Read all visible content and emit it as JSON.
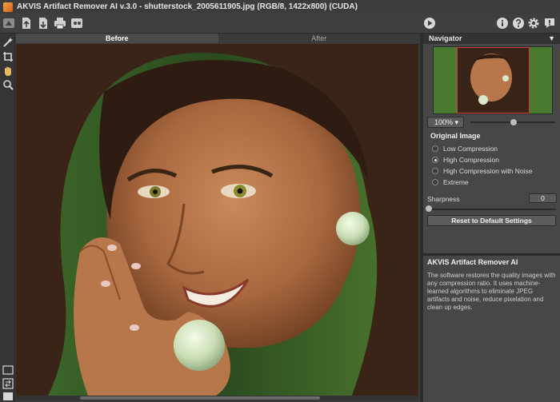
{
  "window": {
    "title": "AKVIS Artifact Remover AI v.3.0 - shutterstock_2005611905.jpg (RGB/8, 1422x800) (CUDA)"
  },
  "toolbar": {
    "left_icons": [
      "home-icon",
      "open-icon",
      "save-icon",
      "print-icon",
      "share-icon"
    ],
    "run_icon": "play-icon",
    "right_icons": [
      "about-icon",
      "help-icon",
      "settings-icon",
      "news-icon"
    ]
  },
  "left_tools": [
    "magic-wand-icon",
    "crop-icon",
    "hand-icon",
    "zoom-icon"
  ],
  "tabs": {
    "before": "Before",
    "after": "After"
  },
  "navigator": {
    "title": "Navigator",
    "zoom_label": "100%"
  },
  "settings": {
    "section_title": "Original Image",
    "options": [
      {
        "label": "Low Compression",
        "selected": false
      },
      {
        "label": "High Compression",
        "selected": true
      },
      {
        "label": "High Compression with Noise",
        "selected": false
      },
      {
        "label": "Extreme",
        "selected": false
      }
    ],
    "sharpness_label": "Sharpness",
    "sharpness_value": "0",
    "reset_label": "Reset to Default Settings"
  },
  "info": {
    "title": "AKVIS Artifact Remover AI",
    "text": "The software restores the quality images with any compression ratio. It uses machine-learned algorithms to eliminate JPEG artifacts and noise, reduce pixelation and clean up edges."
  }
}
